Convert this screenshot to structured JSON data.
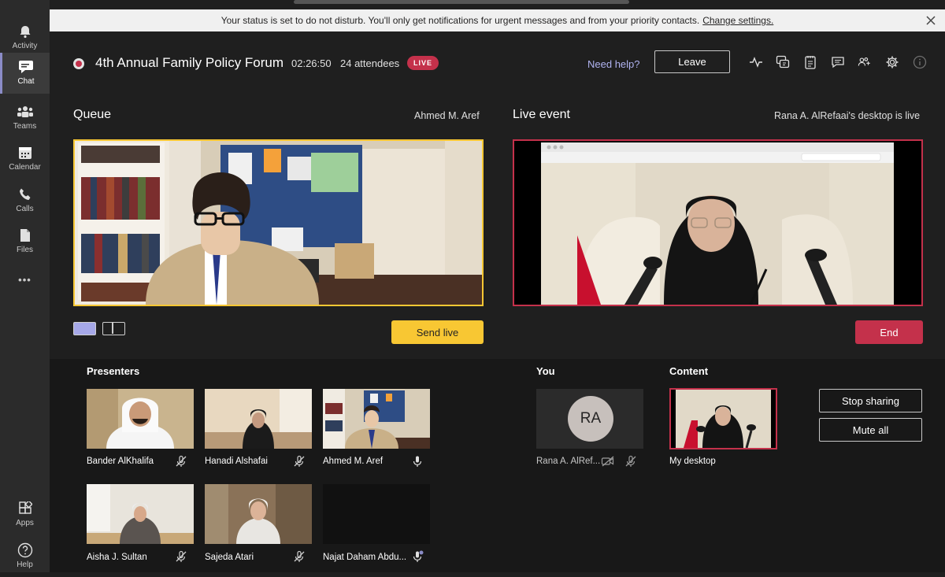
{
  "rail": {
    "items": [
      {
        "label": "Activity",
        "icon": "bell-icon"
      },
      {
        "label": "Chat",
        "icon": "chat-icon"
      },
      {
        "label": "Teams",
        "icon": "teams-icon"
      },
      {
        "label": "Calendar",
        "icon": "calendar-icon"
      },
      {
        "label": "Calls",
        "icon": "phone-icon"
      },
      {
        "label": "Files",
        "icon": "file-icon"
      },
      {
        "label": "Apps",
        "icon": "apps-icon"
      },
      {
        "label": "Help",
        "icon": "help-icon"
      }
    ],
    "more": "•••"
  },
  "banner": {
    "text": "Your status is set to do not disturb. You'll only get notifications for urgent messages and from your priority contacts.",
    "link": "Change settings."
  },
  "event": {
    "title": "4th Annual Family Policy Forum",
    "elapsed": "02:26:50",
    "attendees": "24 attendees",
    "live_badge": "LIVE"
  },
  "header": {
    "need_help": "Need help?",
    "leave": "Leave"
  },
  "queue": {
    "title": "Queue",
    "presenter": "Ahmed M. Aref",
    "send_live": "Send live"
  },
  "live": {
    "title": "Live event",
    "status": "Rana A. AlRefaai's desktop is live",
    "end": "End"
  },
  "presenters": {
    "label": "Presenters",
    "items": [
      {
        "name": "Bander AlKhalifa",
        "mic": "muted"
      },
      {
        "name": "Hanadi Alshafai",
        "mic": "muted"
      },
      {
        "name": "Ahmed M. Aref",
        "mic": "on"
      },
      {
        "name": "Aisha J. Sultan",
        "mic": "muted"
      },
      {
        "name": "Sajeda Atari",
        "mic": "muted"
      },
      {
        "name": "Najat Daham Abdu...",
        "mic": "on"
      }
    ]
  },
  "you": {
    "label": "You",
    "initials": "RA",
    "name": "Rana A. AlRef..."
  },
  "content": {
    "label": "Content",
    "name": "My desktop",
    "stop_sharing": "Stop sharing",
    "mute_all": "Mute all"
  },
  "colors": {
    "accent": "#8b8cc7",
    "live": "#c4314b",
    "queue": "#f8c733",
    "background": "#1f1f1f"
  }
}
